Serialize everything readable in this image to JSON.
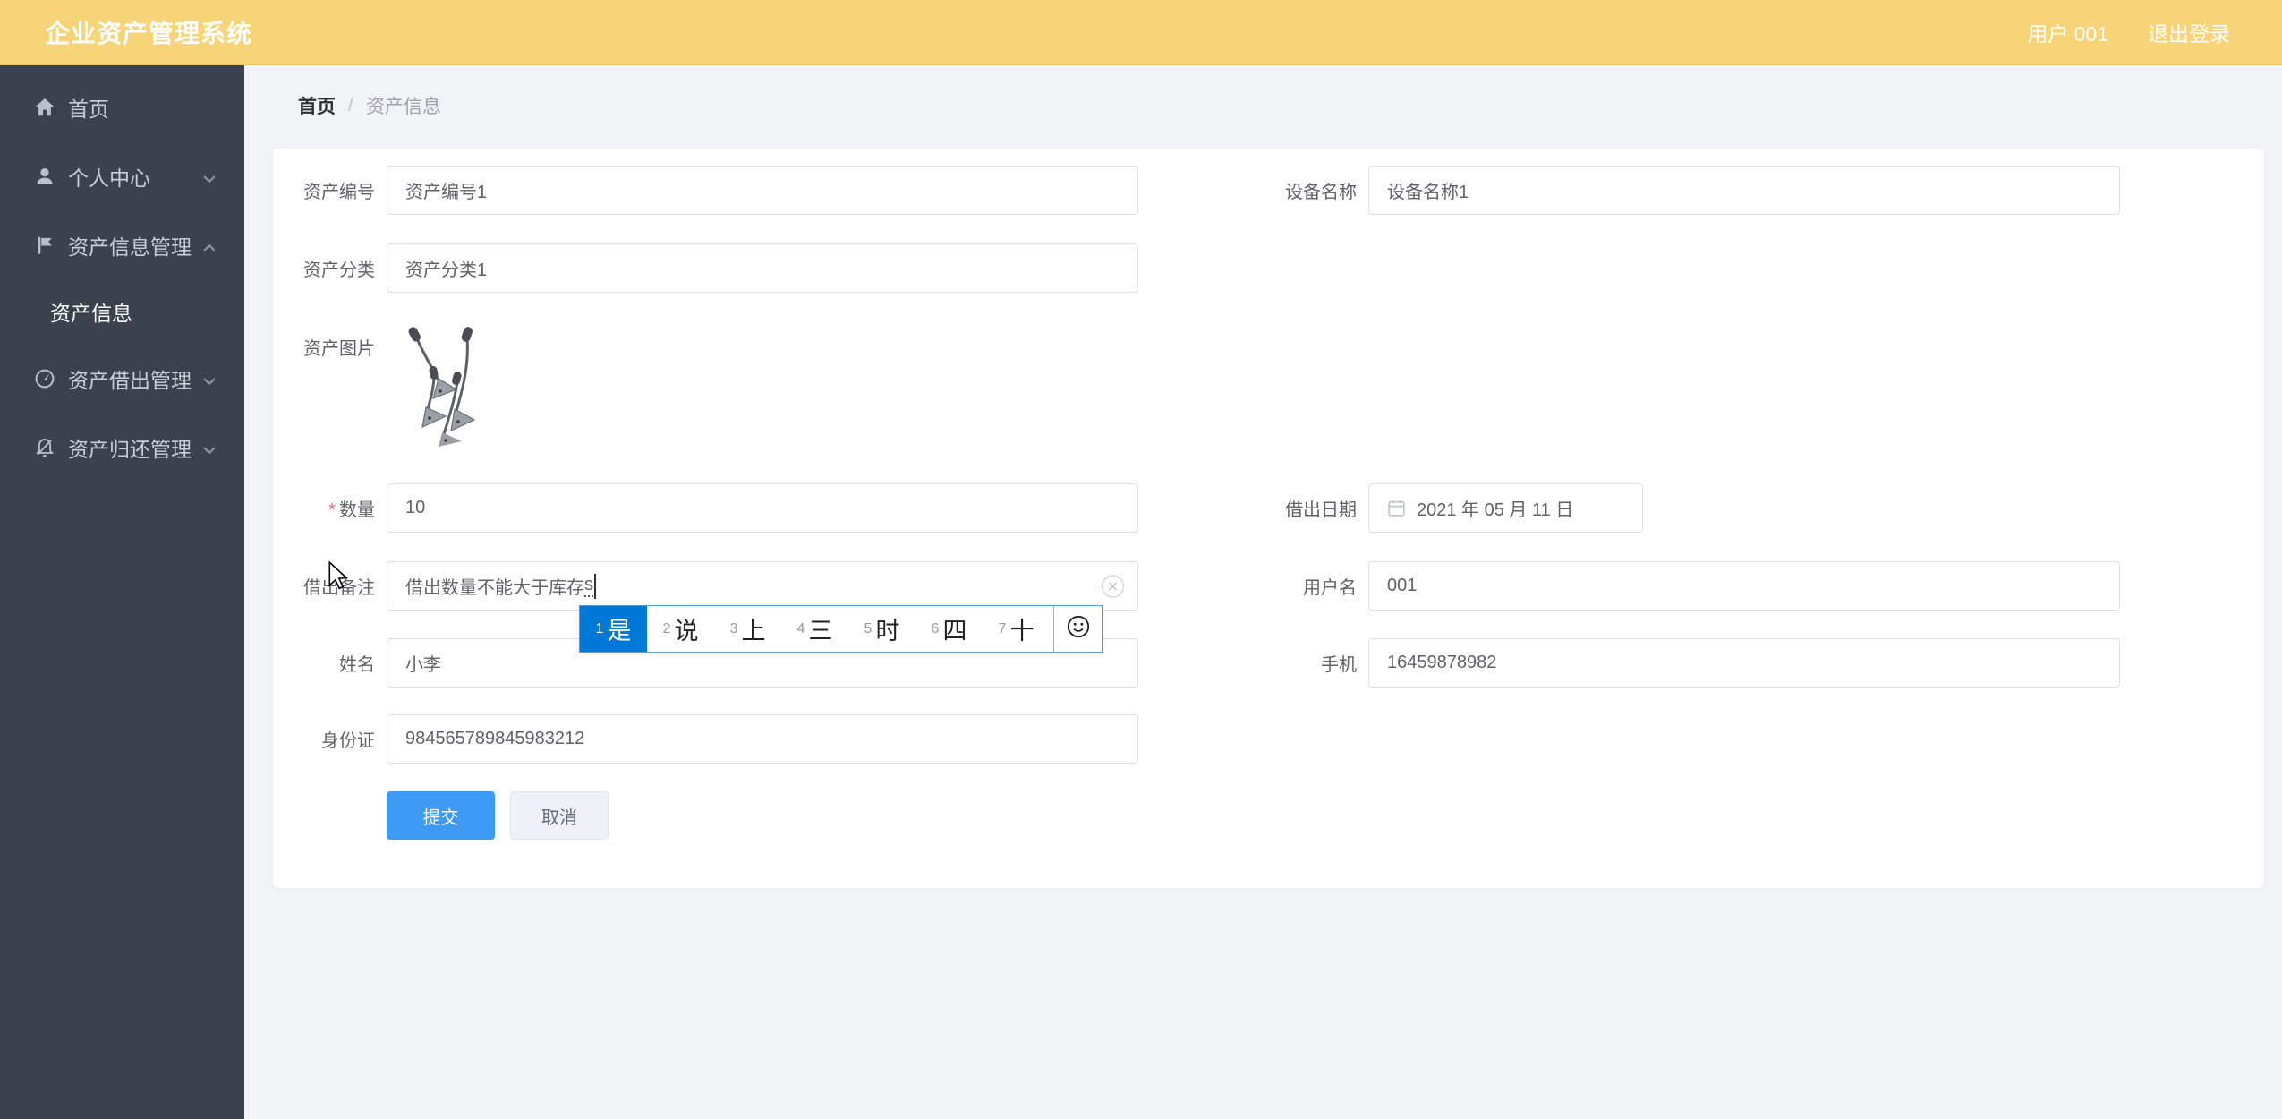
{
  "header": {
    "title": "企业资产管理系统",
    "user": "用户 001",
    "logout": "退出登录"
  },
  "sidebar": {
    "items": [
      {
        "label": "首页",
        "icon": "home-icon"
      },
      {
        "label": "个人中心",
        "icon": "user-icon",
        "chevron": "down"
      },
      {
        "label": "资产信息管理",
        "icon": "flag-icon",
        "chevron": "up"
      },
      {
        "label": "资产信息",
        "submenu": true
      },
      {
        "label": "资产借出管理",
        "icon": "gauge-icon",
        "chevron": "down"
      },
      {
        "label": "资产归还管理",
        "icon": "bell-off-icon",
        "chevron": "down"
      }
    ]
  },
  "breadcrumb": {
    "home": "首页",
    "separator": "/",
    "current": "资产信息"
  },
  "form": {
    "asset_no": {
      "label": "资产编号",
      "value": "资产编号1"
    },
    "device_name": {
      "label": "设备名称",
      "value": "设备名称1"
    },
    "asset_category": {
      "label": "资产分类",
      "value": "资产分类1"
    },
    "asset_image": {
      "label": "资产图片"
    },
    "quantity": {
      "label": "数量",
      "required": "*",
      "value": "10"
    },
    "lend_date": {
      "label": "借出日期",
      "value": "2021 年 05 月 11 日"
    },
    "lend_note": {
      "label": "借出备注",
      "value_committed": "借出数量不能大于库存",
      "value_composing": "s"
    },
    "username": {
      "label": "用户名",
      "value": "001"
    },
    "name": {
      "label": "姓名",
      "value": "小李"
    },
    "phone": {
      "label": "手机",
      "value": "16459878982"
    },
    "id_card": {
      "label": "身份证",
      "value": "984565789845983212"
    },
    "submit_label": "提交",
    "cancel_label": "取消"
  },
  "ime": {
    "candidates": [
      {
        "num": "1",
        "char": "是",
        "selected": true
      },
      {
        "num": "2",
        "char": "说"
      },
      {
        "num": "3",
        "char": "上"
      },
      {
        "num": "4",
        "char": "三"
      },
      {
        "num": "5",
        "char": "时"
      },
      {
        "num": "6",
        "char": "四"
      },
      {
        "num": "7",
        "char": "十"
      }
    ]
  },
  "colors": {
    "header_bg": "#f7d477",
    "sidebar_bg": "#3a434d",
    "primary_blue": "#3d9af5",
    "ime_selected_blue": "#0078d7",
    "required_red": "#f56c6c"
  }
}
